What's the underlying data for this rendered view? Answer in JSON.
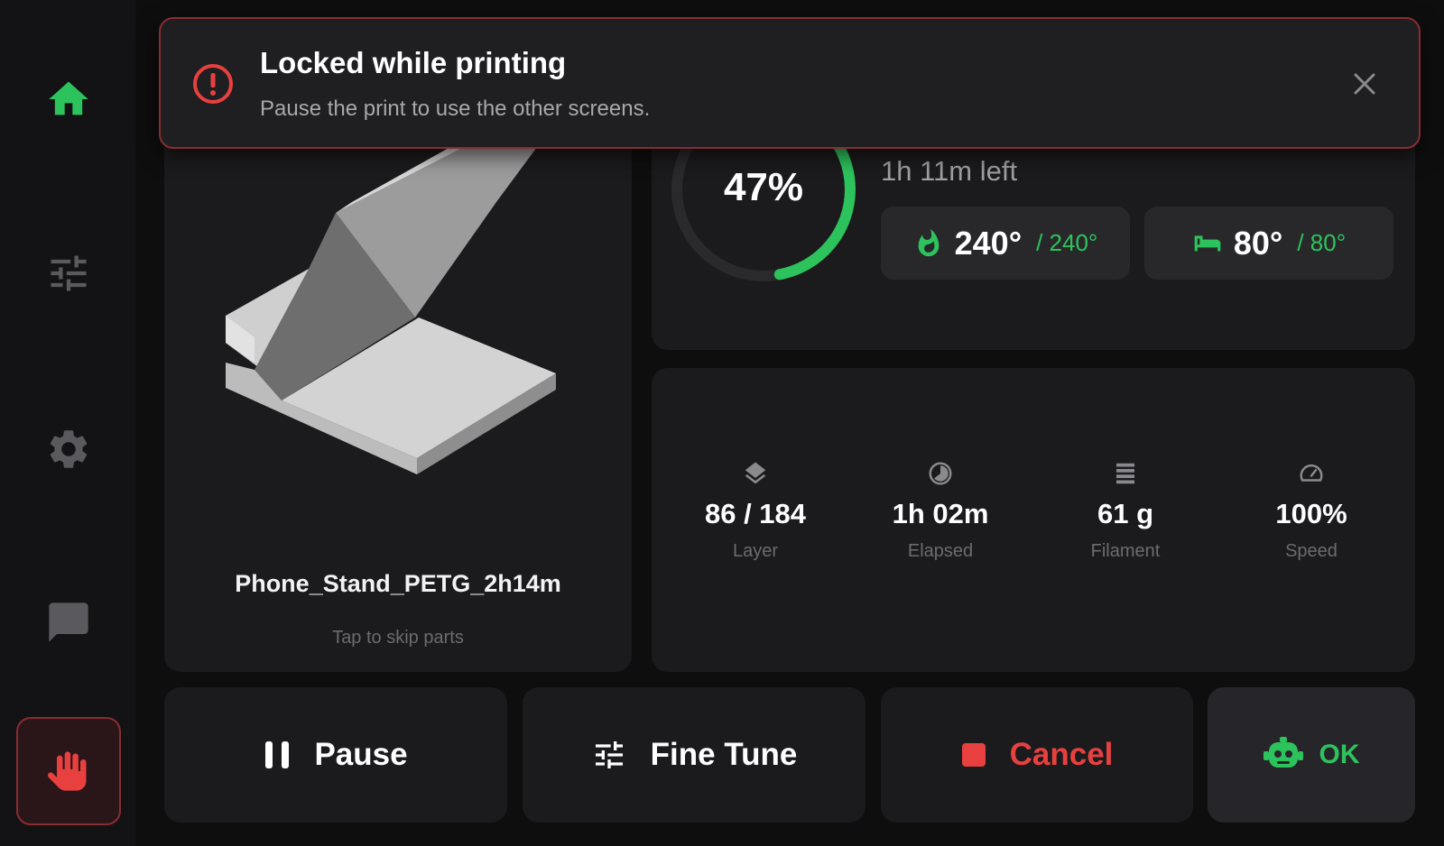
{
  "sidebar": {
    "items": [
      {
        "name": "home",
        "icon": "home-icon",
        "active": true
      },
      {
        "name": "tune",
        "icon": "sliders-icon",
        "active": false
      },
      {
        "name": "settings",
        "icon": "gear-icon",
        "active": false
      },
      {
        "name": "console",
        "icon": "chat-icon",
        "active": false
      },
      {
        "name": "emergency-stop",
        "icon": "hand-stop-icon",
        "active": false
      }
    ]
  },
  "toast": {
    "title": "Locked while printing",
    "message": "Pause the print to use the other screens.",
    "icon": "alert-circle-icon"
  },
  "print": {
    "file_name": "Phone_Stand_PETG_2h14m",
    "skip_hint": "Tap to skip parts",
    "progress": 0.47,
    "progress_label": "47%",
    "time_left": "1h 11m left"
  },
  "temps": {
    "hotend": {
      "current": "240°",
      "target": "/ 240°",
      "icon": "flame-icon"
    },
    "bed": {
      "current": "80°",
      "target": "/ 80°",
      "icon": "bed-icon"
    }
  },
  "stats": [
    {
      "value": "86 / 184",
      "label": "Layer",
      "icon": "layers-icon"
    },
    {
      "value": "1h 02m",
      "label": "Elapsed",
      "icon": "clock-icon"
    },
    {
      "value": "61 g",
      "label": "Filament",
      "icon": "filament-icon"
    },
    {
      "value": "100%",
      "label": "Speed",
      "icon": "speedometer-icon"
    }
  ],
  "actions": {
    "pause": "Pause",
    "fine_tune": "Fine Tune",
    "cancel": "Cancel",
    "ok": "OK"
  },
  "colors": {
    "accent": "#2dc35c",
    "danger": "#e8403f",
    "card": "#1b1b1d",
    "background": "#0e0e0f"
  }
}
